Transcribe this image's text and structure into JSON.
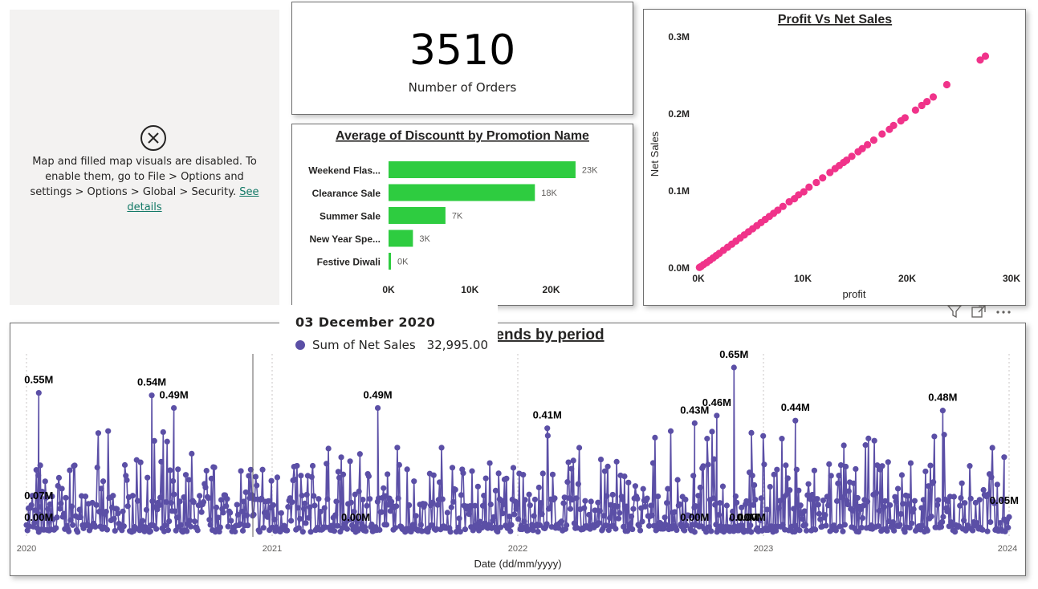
{
  "map_visual": {
    "message": "Map and filled map visuals are disabled. To enable them, go to File > Options and settings > Options > Global > Security.",
    "link_label": "See details",
    "icon": "circle-x-icon"
  },
  "kpi": {
    "value": "3510",
    "label": "Number of Orders"
  },
  "bar_chart": {
    "title": "Average of Discountt by Promotion Name",
    "x_ticks": [
      "0K",
      "10K",
      "20K"
    ],
    "color": "#2ecc40"
  },
  "scatter_chart": {
    "title": "Profit Vs Net Sales",
    "xlabel": "profit",
    "ylabel": "Net Sales",
    "x_ticks": [
      "0K",
      "10K",
      "20K",
      "30K"
    ],
    "y_ticks": [
      "0.0M",
      "0.1M",
      "0.2M",
      "0.3M"
    ],
    "color": "#f0338a"
  },
  "line_chart": {
    "title_partial": "ends by period",
    "xlabel": "Date (dd/mm/yyyy)",
    "x_ticks": [
      "2020",
      "2021",
      "2022",
      "2023",
      "2024"
    ],
    "color": "#5b4fa6"
  },
  "tooltip": {
    "date": "03 December 2020",
    "series": "Sum of Net Sales",
    "value": "32,995.00"
  },
  "header_icons": [
    "filter-icon",
    "focus-mode-icon",
    "more-options-icon"
  ],
  "chart_data": [
    {
      "type": "bar",
      "title": "Average of Discountt by Promotion Name",
      "categories": [
        "Weekend Flas...",
        "Clearance Sale",
        "Summer Sale",
        "New Year Spe...",
        "Festive Diwali"
      ],
      "values": [
        23000,
        18000,
        7000,
        3000,
        0
      ],
      "value_labels": [
        "23K",
        "18K",
        "7K",
        "3K",
        "0K"
      ],
      "xlim": [
        0,
        23500
      ],
      "orientation": "horizontal"
    },
    {
      "type": "scatter",
      "title": "Profit Vs Net Sales",
      "xlabel": "profit",
      "ylabel": "Net Sales",
      "xlim": [
        0,
        30000
      ],
      "ylim": [
        0,
        300000
      ],
      "points": [
        [
          27500,
          275000
        ],
        [
          27000,
          270000
        ],
        [
          23800,
          238000
        ],
        [
          22500,
          222000
        ],
        [
          21900,
          216000
        ],
        [
          21400,
          211000
        ],
        [
          20800,
          205000
        ],
        [
          19800,
          195000
        ],
        [
          19400,
          191000
        ],
        [
          18700,
          185000
        ],
        [
          18300,
          180000
        ],
        [
          17600,
          174000
        ],
        [
          16800,
          166000
        ],
        [
          16200,
          160000
        ],
        [
          15700,
          155000
        ],
        [
          15300,
          151000
        ],
        [
          14700,
          145000
        ],
        [
          14200,
          140000
        ],
        [
          13900,
          137000
        ],
        [
          13500,
          133000
        ],
        [
          13100,
          129000
        ],
        [
          12600,
          124000
        ],
        [
          11900,
          117000
        ],
        [
          11300,
          111000
        ],
        [
          10600,
          105000
        ],
        [
          10100,
          99000
        ],
        [
          9600,
          95000
        ],
        [
          9200,
          90000
        ],
        [
          8700,
          86000
        ],
        [
          8100,
          80000
        ],
        [
          7600,
          75000
        ],
        [
          7200,
          71000
        ],
        [
          6800,
          67000
        ],
        [
          6400,
          63000
        ],
        [
          6000,
          59000
        ],
        [
          5600,
          55000
        ],
        [
          5200,
          51000
        ],
        [
          4800,
          47000
        ],
        [
          4400,
          43000
        ],
        [
          4000,
          39000
        ],
        [
          3600,
          35000
        ],
        [
          3200,
          31000
        ],
        [
          2800,
          27000
        ],
        [
          2400,
          23000
        ],
        [
          2000,
          19000
        ],
        [
          1700,
          16000
        ],
        [
          1400,
          13000
        ],
        [
          1100,
          10000
        ],
        [
          800,
          7000
        ],
        [
          500,
          4500
        ],
        [
          250,
          2000
        ],
        [
          100,
          800
        ]
      ]
    },
    {
      "type": "line",
      "title": "",
      "xlabel": "Date (dd/mm/yyyy)",
      "x_range": [
        "2020",
        "2024"
      ],
      "ylim": [
        0,
        650000
      ],
      "annotations": [
        {
          "x": 2020.05,
          "y": 550000,
          "label": "0.55M"
        },
        {
          "x": 2020.05,
          "y": 70000,
          "label": "0.07M"
        },
        {
          "x": 2020.05,
          "y": 0,
          "label": "0.00M"
        },
        {
          "x": 2020.51,
          "y": 540000,
          "label": "0.54M"
        },
        {
          "x": 2020.6,
          "y": 490000,
          "label": "0.49M"
        },
        {
          "x": 2021.34,
          "y": 0,
          "label": "0.00M"
        },
        {
          "x": 2021.43,
          "y": 490000,
          "label": "0.49M"
        },
        {
          "x": 2022.12,
          "y": 410000,
          "label": "0.41M"
        },
        {
          "x": 2022.72,
          "y": 430000,
          "label": "0.43M"
        },
        {
          "x": 2022.81,
          "y": 460000,
          "label": "0.46M"
        },
        {
          "x": 2022.88,
          "y": 650000,
          "label": "0.65M"
        },
        {
          "x": 2022.72,
          "y": 0,
          "label": "0.00M"
        },
        {
          "x": 2022.95,
          "y": 0,
          "label": "0.00M"
        },
        {
          "x": 2022.92,
          "y": 0,
          "label": "0.00M"
        },
        {
          "x": 2023.13,
          "y": 440000,
          "label": "0.44M"
        },
        {
          "x": 2023.73,
          "y": 480000,
          "label": "0.48M"
        },
        {
          "x": 2023.98,
          "y": 50000,
          "label": "0.05M"
        }
      ]
    }
  ]
}
